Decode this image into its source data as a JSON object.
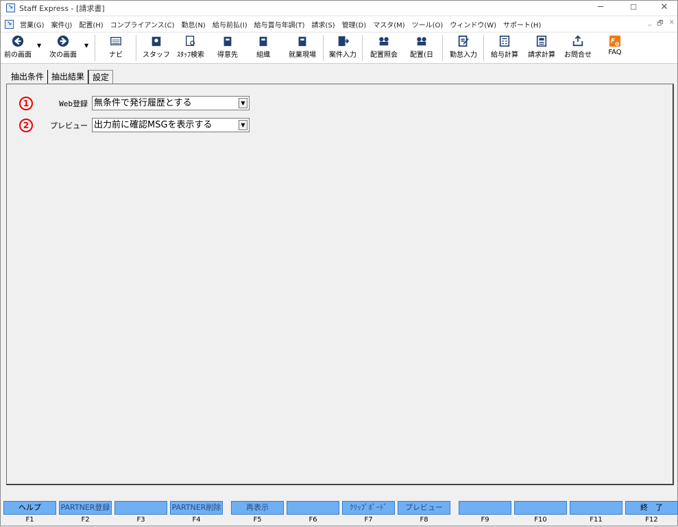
{
  "window": {
    "title": "Staff Express - [請求書]",
    "min": "─",
    "max": "☐",
    "close": "✕"
  },
  "menu": {
    "items": [
      "営業(G)",
      "案件(J)",
      "配置(H)",
      "コンプライアンス(C)",
      "勤怠(N)",
      "給与前払(I)",
      "給与賞与年調(T)",
      "請求(S)",
      "管理(D)",
      "マスタ(M)",
      "ツール(O)",
      "ウィンドウ(W)",
      "サポート(H)"
    ],
    "mdi": [
      "_",
      "🗗",
      "×"
    ]
  },
  "toolbar": {
    "items": [
      {
        "label": "前の画面",
        "icon": "back-arrow"
      },
      {
        "label": "次の画面",
        "icon": "forward-arrow"
      },
      {
        "label": "ナビ",
        "icon": "navi"
      },
      {
        "label": "スタッフ",
        "icon": "staff"
      },
      {
        "label": "ｽﾀｯﾌ検索",
        "icon": "staff-search"
      },
      {
        "label": "得意先",
        "icon": "client"
      },
      {
        "label": "組織",
        "icon": "org"
      },
      {
        "label": "就業現場",
        "icon": "worksite"
      },
      {
        "label": "案件入力",
        "icon": "case-input"
      },
      {
        "label": "配置照会",
        "icon": "placement-inquiry"
      },
      {
        "label": "配置(日",
        "icon": "placement-day"
      },
      {
        "label": "勤怠入力",
        "icon": "attendance"
      },
      {
        "label": "給与計算",
        "icon": "payroll"
      },
      {
        "label": "請求計算",
        "icon": "billing"
      },
      {
        "label": "お問合せ",
        "icon": "inquiry"
      },
      {
        "label": "FAQ",
        "icon": "faq"
      }
    ]
  },
  "tabs": [
    {
      "label": "抽出条件"
    },
    {
      "label": "抽出結果"
    },
    {
      "label": "設定",
      "active": true
    }
  ],
  "settings": [
    {
      "num": "1",
      "label": "Web登録",
      "value": "無条件で発行履歴とする"
    },
    {
      "num": "2",
      "label": "プレビュー",
      "value": "出力前に確認MSGを表示する"
    }
  ],
  "fkeys": [
    {
      "label": "ヘルプ",
      "key": "F1",
      "enabled": true
    },
    {
      "label": "PARTNER登録",
      "key": "F2",
      "enabled": false
    },
    {
      "label": "",
      "key": "F3",
      "enabled": false
    },
    {
      "label": "PARTNER削除",
      "key": "F4",
      "enabled": false
    },
    {
      "label": "再表示",
      "key": "F5",
      "enabled": false
    },
    {
      "label": "",
      "key": "F6",
      "enabled": false
    },
    {
      "label": "ｸﾘｯﾌﾟﾎﾞｰﾄﾞ",
      "key": "F7",
      "enabled": false
    },
    {
      "label": "プレビュー",
      "key": "F8",
      "enabled": false
    },
    {
      "label": "",
      "key": "F9",
      "enabled": false
    },
    {
      "label": "",
      "key": "F10",
      "enabled": false
    },
    {
      "label": "",
      "key": "F11",
      "enabled": false
    },
    {
      "label": "終　了",
      "key": "F12",
      "enabled": true
    }
  ],
  "colors": {
    "fkey": "#6fb0f5",
    "marker": "#e00000",
    "toolbar_icon": "#1f3f6e"
  }
}
